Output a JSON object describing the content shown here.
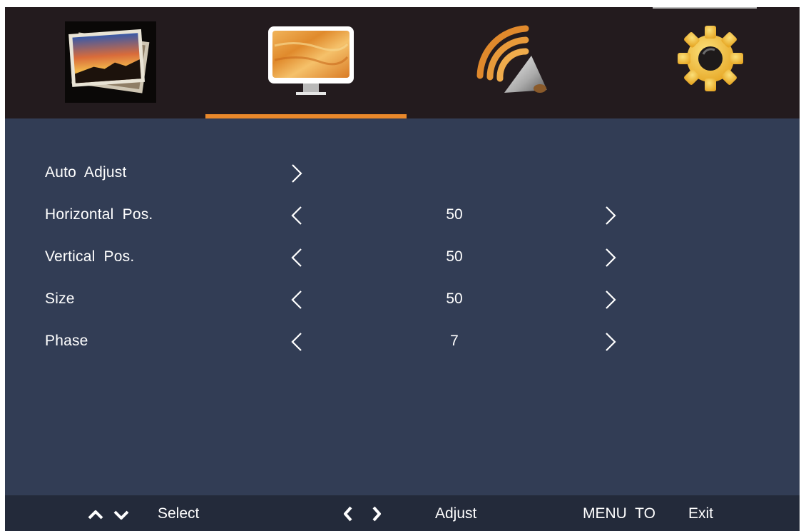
{
  "tabs": [
    {
      "icon": "picture-icon",
      "selected": false
    },
    {
      "icon": "display-monitor-icon",
      "selected": true
    },
    {
      "icon": "signal-source-icon",
      "selected": false
    },
    {
      "icon": "gear-settings-icon",
      "selected": false
    }
  ],
  "menu": {
    "items": [
      {
        "label": "Auto  Adjust",
        "type": "action"
      },
      {
        "label": "Horizontal  Pos.",
        "value": "50",
        "type": "adjust"
      },
      {
        "label": "Vertical  Pos.",
        "value": "50",
        "type": "adjust"
      },
      {
        "label": "Size",
        "value": "50",
        "type": "adjust"
      },
      {
        "label": "Phase",
        "value": "7",
        "type": "adjust"
      }
    ]
  },
  "footer": {
    "select_label": "Select",
    "adjust_label": "Adjust",
    "menu_label": "MENU  TO",
    "exit_label": "Exit"
  },
  "colors": {
    "accent": "#e8882b",
    "header_bg": "#231b1e",
    "panel_bg": "#323d55",
    "footer_bg": "#232a3a"
  }
}
